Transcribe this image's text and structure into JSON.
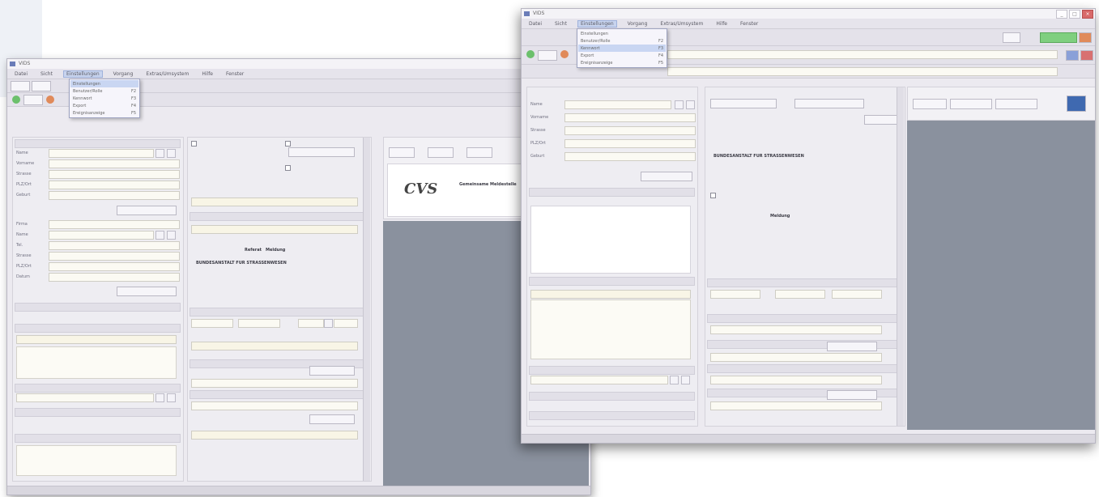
{
  "window1": {
    "title": "VIDS",
    "menu": [
      "Datei",
      "Sicht",
      "Einstellungen",
      "Vorgang",
      "Extras/Umsystem",
      "Hilfe",
      "Fenster"
    ],
    "active_menu_index": 2,
    "dropdown": [
      {
        "label": "Einstellungen",
        "shortcut": ""
      },
      {
        "label": "Benutzer/Rolle",
        "shortcut": "F2"
      },
      {
        "label": "Kennwort",
        "shortcut": "F3"
      },
      {
        "label": "Export",
        "shortcut": "F4"
      },
      {
        "label": "Ereignisanzeige",
        "shortcut": "F5"
      }
    ],
    "form_labels_top": [
      "Name",
      "Vorname",
      "Strasse",
      "PLZ/Ort",
      "Geburt"
    ],
    "form_labels_mid": [
      "Firma",
      "Name",
      "Tel.",
      "Strasse",
      "PLZ/Ort",
      "Datum"
    ],
    "logo_text": "CVS",
    "logo_caption": "Gemeinsame Meldestelle",
    "bold_lines": [
      "BUNDESANSTALT FUR STRASSENWESEN",
      "Referat",
      "Meldung"
    ]
  },
  "window2": {
    "title": "VIDS",
    "menu": [
      "Datei",
      "Sicht",
      "Einstellungen",
      "Vorgang",
      "Extras/Umsystem",
      "Hilfe",
      "Fenster"
    ],
    "active_menu_index": 2,
    "dropdown": [
      {
        "label": "Einstellungen",
        "shortcut": ""
      },
      {
        "label": "Benutzer/Rolle",
        "shortcut": "F2"
      },
      {
        "label": "Kennwort",
        "shortcut": "F3"
      },
      {
        "label": "Export",
        "shortcut": "F4"
      },
      {
        "label": "Ereignisanzeige",
        "shortcut": "F5"
      }
    ],
    "form_labels": [
      "Name",
      "Vorname",
      "Strasse",
      "PLZ/Ort",
      "Geburt"
    ],
    "bold_lines": [
      "BUNDESANSTALT FUR STRASSENWESEN",
      "Meldung"
    ]
  },
  "colors": {
    "accent": "#9fb2dc",
    "green": "#7fcf7f",
    "red": "#d86a6a",
    "gray_panel": "#8a919e"
  }
}
